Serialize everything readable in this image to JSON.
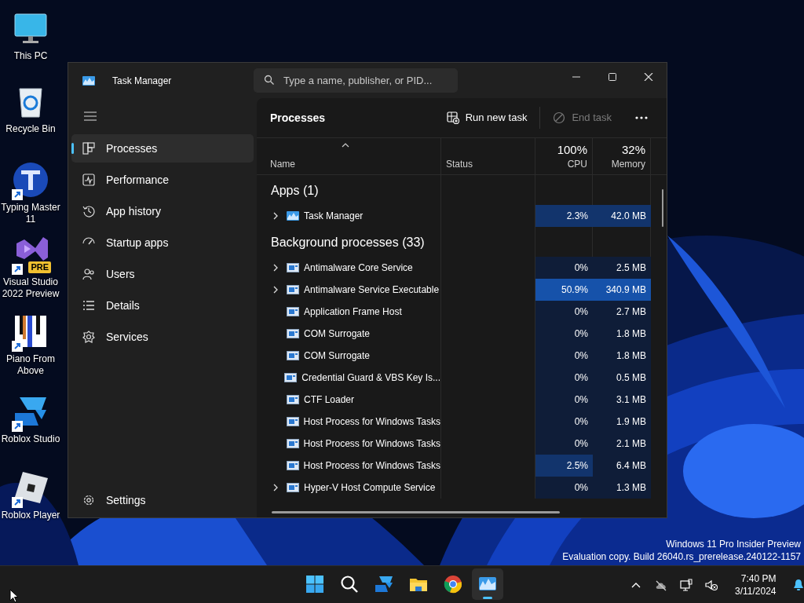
{
  "desktop_icons": [
    {
      "label": "This PC",
      "kind": "monitor",
      "shortcut": false
    },
    {
      "label": "Recycle Bin",
      "kind": "bin",
      "shortcut": false
    },
    {
      "label": "Typing Master 11",
      "kind": "typing",
      "shortcut": true
    },
    {
      "label": "Visual Studio 2022 Preview",
      "kind": "vs",
      "shortcut": true,
      "badge": "PRE"
    },
    {
      "label": "Piano From Above",
      "kind": "piano",
      "shortcut": true
    },
    {
      "label": "Roblox Studio",
      "kind": "studio",
      "shortcut": true
    },
    {
      "label": "Roblox Player",
      "kind": "player",
      "shortcut": true
    }
  ],
  "window": {
    "title": "Task Manager",
    "search": {
      "placeholder": "Type a name, publisher, or PID..."
    }
  },
  "sidebar": {
    "items": [
      {
        "label": "Processes",
        "kind": "processes",
        "selected": true
      },
      {
        "label": "Performance",
        "kind": "performance",
        "selected": false
      },
      {
        "label": "App history",
        "kind": "history",
        "selected": false
      },
      {
        "label": "Startup apps",
        "kind": "startup",
        "selected": false
      },
      {
        "label": "Users",
        "kind": "users",
        "selected": false
      },
      {
        "label": "Details",
        "kind": "details",
        "selected": false
      },
      {
        "label": "Services",
        "kind": "services",
        "selected": false
      }
    ],
    "footer": {
      "label": "Settings",
      "kind": "settings",
      "selected": false
    }
  },
  "page": {
    "title": "Processes",
    "actions": [
      {
        "label": "Run new task",
        "kind": "run",
        "disabled": false
      },
      {
        "label": "End task",
        "kind": "end",
        "disabled": true
      }
    ]
  },
  "table": {
    "columns": [
      {
        "label": "Name"
      },
      {
        "label": "Status"
      },
      {
        "label": "CPU",
        "total": "100%"
      },
      {
        "label": "Memory",
        "total": "32%"
      }
    ],
    "groups": [
      {
        "title": "Apps (1)",
        "rows": [
          {
            "name": "Task Manager",
            "kind": "app",
            "expandable": true,
            "cpu": {
              "text": "2.3%",
              "color": "#12346c"
            },
            "memory": {
              "text": "42.0 MB",
              "color": "#12346c"
            }
          }
        ]
      },
      {
        "title": "Background processes (33)",
        "rows": [
          {
            "name": "Antimalware Core Service",
            "kind": "process",
            "expandable": true,
            "cpu": {
              "text": "0%",
              "color": "#0f1d38"
            },
            "memory": {
              "text": "2.5 MB",
              "color": "#0f1d38"
            }
          },
          {
            "name": "Antimalware Service Executable",
            "kind": "process",
            "expandable": true,
            "cpu": {
              "text": "50.9%",
              "color": "#1652aa"
            },
            "memory": {
              "text": "340.9 MB",
              "color": "#1652aa"
            }
          },
          {
            "name": "Application Frame Host",
            "kind": "process",
            "expandable": false,
            "cpu": {
              "text": "0%",
              "color": "#0f1d38"
            },
            "memory": {
              "text": "2.7 MB",
              "color": "#0f1d38"
            }
          },
          {
            "name": "COM Surrogate",
            "kind": "process",
            "expandable": false,
            "cpu": {
              "text": "0%",
              "color": "#0f1d38"
            },
            "memory": {
              "text": "1.8 MB",
              "color": "#0f1d38"
            }
          },
          {
            "name": "COM Surrogate",
            "kind": "process",
            "expandable": false,
            "cpu": {
              "text": "0%",
              "color": "#0f1d38"
            },
            "memory": {
              "text": "1.8 MB",
              "color": "#0f1d38"
            }
          },
          {
            "name": "Credential Guard & VBS Key Is...",
            "kind": "process",
            "expandable": false,
            "cpu": {
              "text": "0%",
              "color": "#0f1d38"
            },
            "memory": {
              "text": "0.5 MB",
              "color": "#0f1d38"
            }
          },
          {
            "name": "CTF Loader",
            "kind": "process",
            "expandable": false,
            "cpu": {
              "text": "0%",
              "color": "#0f1d38"
            },
            "memory": {
              "text": "3.1 MB",
              "color": "#0f1d38"
            }
          },
          {
            "name": "Host Process for Windows Tasks",
            "kind": "process",
            "expandable": false,
            "cpu": {
              "text": "0%",
              "color": "#0f1d38"
            },
            "memory": {
              "text": "1.9 MB",
              "color": "#0f1d38"
            }
          },
          {
            "name": "Host Process for Windows Tasks",
            "kind": "process",
            "expandable": false,
            "cpu": {
              "text": "0%",
              "color": "#0f1d38"
            },
            "memory": {
              "text": "2.1 MB",
              "color": "#0f1d38"
            }
          },
          {
            "name": "Host Process for Windows Tasks",
            "kind": "process",
            "expandable": false,
            "cpu": {
              "text": "2.5%",
              "color": "#12346c"
            },
            "memory": {
              "text": "6.4 MB",
              "color": "#0f1d38"
            }
          },
          {
            "name": "Hyper-V Host Compute Service",
            "kind": "process",
            "expandable": true,
            "cpu": {
              "text": "0%",
              "color": "#0f1d38"
            },
            "memory": {
              "text": "1.3 MB",
              "color": "#0f1d38"
            }
          }
        ]
      }
    ]
  },
  "system_notice": [
    "Windows 11 Pro Insider Preview",
    "Evaluation copy. Build 26040.rs_prerelease.240122-1157"
  ],
  "taskbar": {
    "apps": [
      {
        "kind": "start",
        "active": false
      },
      {
        "kind": "search",
        "active": false
      },
      {
        "kind": "studio",
        "active": false
      },
      {
        "kind": "explorer",
        "active": false
      },
      {
        "kind": "chrome",
        "active": false
      },
      {
        "kind": "taskmgr",
        "active": true
      }
    ],
    "tray": [
      {
        "kind": "chevron"
      },
      {
        "kind": "cloud"
      },
      {
        "kind": "network"
      },
      {
        "kind": "volume"
      }
    ],
    "clock": {
      "time": "7:40 PM",
      "date": "3/11/2024"
    }
  }
}
